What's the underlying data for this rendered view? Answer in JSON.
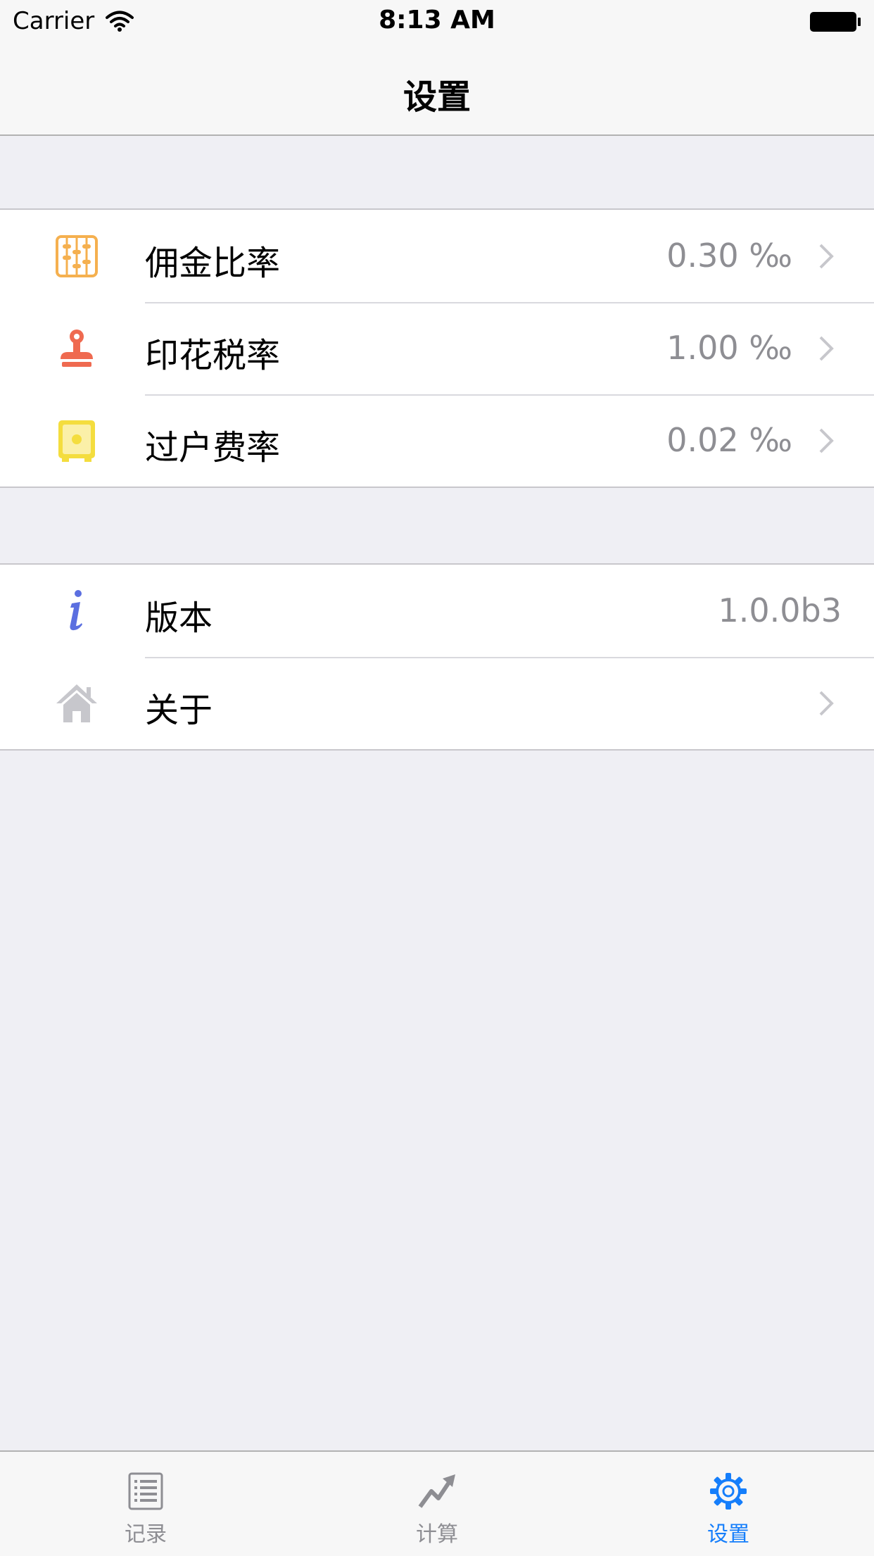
{
  "status_bar": {
    "carrier": "Carrier",
    "time": "8:13 AM",
    "icons": [
      "wifi-icon",
      "battery-icon"
    ]
  },
  "nav": {
    "title": "设置"
  },
  "groups": [
    {
      "rows": [
        {
          "icon": "abacus-icon",
          "icon_color": "#f5b04f",
          "label": "佣金比率",
          "value": "0.30 ‰",
          "chevron": true
        },
        {
          "icon": "stamp-icon",
          "icon_color": "#ef6a50",
          "label": "印花税率",
          "value": "1.00 ‰",
          "chevron": true
        },
        {
          "icon": "safe-icon",
          "icon_color": "#f4dd3e",
          "label": "过户费率",
          "value": "0.02 ‰",
          "chevron": true
        }
      ]
    },
    {
      "rows": [
        {
          "icon": "info-icon",
          "icon_color": "#5b6fe0",
          "label": "版本",
          "value": "1.0.0b3",
          "chevron": false
        },
        {
          "icon": "home-icon",
          "icon_color": "#c7c7cc",
          "label": "关于",
          "value": "",
          "chevron": true
        }
      ]
    }
  ],
  "tab_bar": {
    "active_color": "#157efb",
    "inactive_color": "#8e8e93",
    "tabs": [
      {
        "icon": "list-icon",
        "label": "记录",
        "active": false
      },
      {
        "icon": "trend-arrow-icon",
        "label": "计算",
        "active": false
      },
      {
        "icon": "gear-icon",
        "label": "设置",
        "active": true
      }
    ]
  }
}
